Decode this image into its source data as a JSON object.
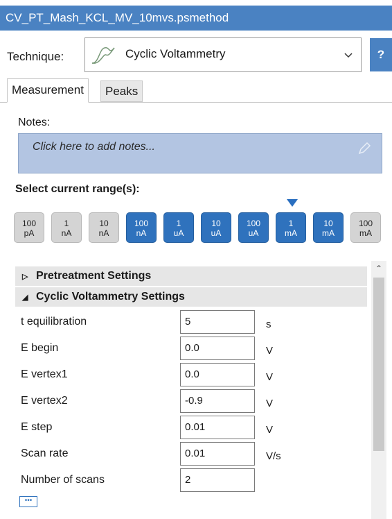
{
  "window": {
    "title": "CV_PT_Mash_KCL_MV_10mvs.psmethod"
  },
  "technique": {
    "label": "Technique:",
    "value": "Cyclic Voltammetry",
    "icon": "cyclic-voltammetry-icon",
    "help_label": "?"
  },
  "tabs": [
    {
      "label": "Measurement"
    },
    {
      "label": "Peaks"
    }
  ],
  "notes": {
    "label": "Notes:",
    "placeholder": "Click here to add notes..."
  },
  "current_range": {
    "label": "Select current range(s):",
    "ranges": [
      {
        "value": "100",
        "unit": "pA",
        "selected": false
      },
      {
        "value": "1",
        "unit": "nA",
        "selected": false
      },
      {
        "value": "10",
        "unit": "nA",
        "selected": false
      },
      {
        "value": "100",
        "unit": "nA",
        "selected": true
      },
      {
        "value": "1",
        "unit": "uA",
        "selected": true
      },
      {
        "value": "10",
        "unit": "uA",
        "selected": true
      },
      {
        "value": "100",
        "unit": "uA",
        "selected": true
      },
      {
        "value": "1",
        "unit": "mA",
        "selected": true
      },
      {
        "value": "10",
        "unit": "mA",
        "selected": true
      },
      {
        "value": "100",
        "unit": "mA",
        "selected": false
      }
    ]
  },
  "sections": {
    "pretreatment": {
      "label": "Pretreatment Settings",
      "expanded": false
    },
    "cv": {
      "label": "Cyclic Voltammetry Settings",
      "expanded": true
    }
  },
  "params": [
    {
      "label": "t equilibration",
      "value": "5",
      "unit": "s"
    },
    {
      "label": "E begin",
      "value": "0.0",
      "unit": "V"
    },
    {
      "label": "E vertex1",
      "value": "0.0",
      "unit": "V"
    },
    {
      "label": "E vertex2",
      "value": "-0.9",
      "unit": "V"
    },
    {
      "label": "E step",
      "value": "0.01",
      "unit": "V"
    },
    {
      "label": "Scan rate",
      "value": "0.01",
      "unit": "V/s"
    },
    {
      "label": "Number of scans",
      "value": "2",
      "unit": ""
    }
  ],
  "more_button": {
    "label": "•••"
  },
  "colors": {
    "accent": "#2f72bd",
    "titlebar": "#4a82c2",
    "notes_bg": "#b3c5e2"
  }
}
